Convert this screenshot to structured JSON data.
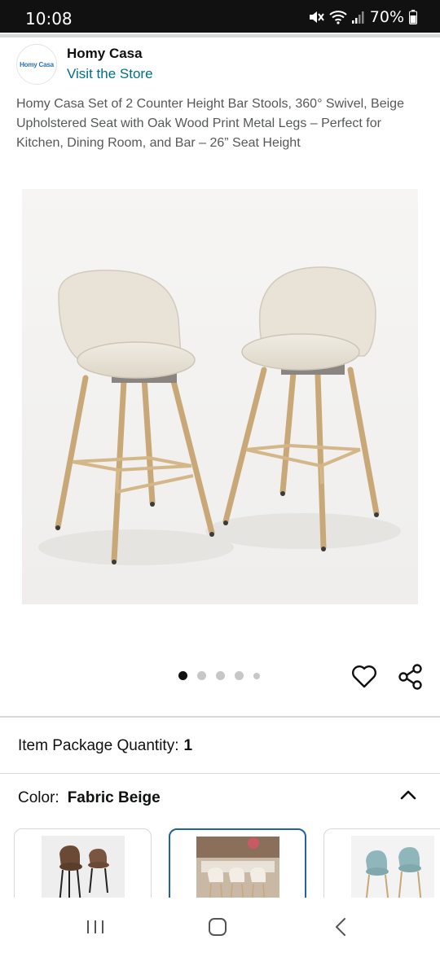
{
  "status_bar": {
    "time": "10:08",
    "battery": "70%"
  },
  "seller": {
    "logo_text": "Homy Casa",
    "name": "Homy Casa",
    "visit_store": "Visit the Store"
  },
  "product": {
    "title": "Homy Casa Set of 2 Counter Height Bar Stools, 360° Swivel, Beige Upholstered Seat with Oak Wood Print Metal Legs – Perfect for Kitchen, Dining Room, and Bar – 26” Seat Height",
    "image_alt": "Two beige upholstered bar stools with oak wood print metal legs",
    "carousel": {
      "total": 5,
      "active_index": 0
    }
  },
  "quantity": {
    "label": "Item Package Quantity:",
    "value": "1"
  },
  "color": {
    "label": "Color:",
    "value": "Fabric Beige",
    "options": [
      {
        "name": "brown-leather",
        "selected": false,
        "seat": "#6b4a35"
      },
      {
        "name": "fabric-beige",
        "selected": true,
        "seat": "#ece6da"
      },
      {
        "name": "blue-velvet",
        "selected": false,
        "seat": "#8fb7bb"
      }
    ]
  },
  "colors": {
    "link": "#007185",
    "selected_border": "#2162a1",
    "text": "#0f1111",
    "muted": "#565959"
  },
  "icons": {
    "heart": "heart-icon",
    "share": "share-icon",
    "chevron": "chevron-up-icon"
  }
}
